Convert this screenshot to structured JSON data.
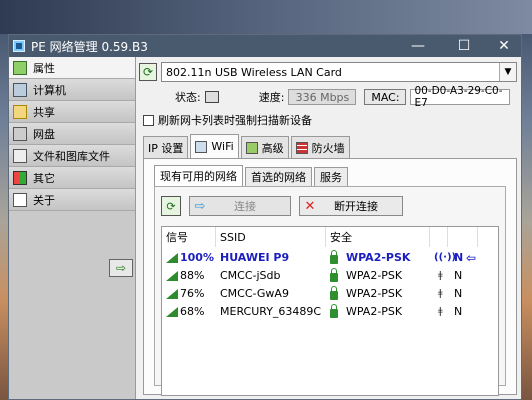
{
  "window": {
    "title": "PE 网络管理 0.59.B3",
    "controls": [
      "—",
      "☐",
      "✕"
    ]
  },
  "sidebar": {
    "items": [
      {
        "label": "属性",
        "icon": "properties-icon",
        "active": true
      },
      {
        "label": "计算机",
        "icon": "computer-icon",
        "active": false
      },
      {
        "label": "共享",
        "icon": "share-icon",
        "active": false
      },
      {
        "label": "网盘",
        "icon": "network-drive-icon",
        "active": false
      },
      {
        "label": "文件和图库文件",
        "icon": "files-icon",
        "active": false
      },
      {
        "label": "其它",
        "icon": "other-icon",
        "active": false
      },
      {
        "label": "关于",
        "icon": "about-icon",
        "active": false
      }
    ],
    "collapse_glyph": "⇨"
  },
  "adapter": {
    "selected": "802.11n USB Wireless LAN Card"
  },
  "status": {
    "state_label": "状态:",
    "speed_label": "速度:",
    "speed_value": "336 Mbps",
    "mac_label": "MAC:",
    "mac_value": "00-D0-A3-29-C0-E7"
  },
  "options": {
    "force_scan_label": "刷新网卡列表时强制扫描新设备"
  },
  "tabs": [
    {
      "label": "IP 设置",
      "active": false
    },
    {
      "label": "WiFi",
      "active": true
    },
    {
      "label": "高级",
      "active": false
    },
    {
      "label": "防火墙",
      "active": false
    }
  ],
  "subtabs": [
    {
      "label": "现有可用的网络",
      "active": true
    },
    {
      "label": "首选的网络",
      "active": false
    },
    {
      "label": "服务",
      "active": false
    }
  ],
  "actions": {
    "connect_label": "连接",
    "disconnect_label": "断开连接"
  },
  "table": {
    "headers": [
      "信号",
      "SSID",
      "安全"
    ],
    "rows": [
      {
        "signal": "100%",
        "ssid": "HUAWEI P9",
        "security": "WPA2-PSK",
        "mode": "N",
        "selected": true
      },
      {
        "signal": "88%",
        "ssid": "CMCC-jSdb",
        "security": "WPA2-PSK",
        "mode": "N",
        "selected": false
      },
      {
        "signal": "76%",
        "ssid": "CMCC-GwA9",
        "security": "WPA2-PSK",
        "mode": "N",
        "selected": false
      },
      {
        "signal": "68%",
        "ssid": "MERCURY_63489C",
        "security": "WPA2-PSK",
        "mode": "N",
        "selected": false
      }
    ]
  }
}
